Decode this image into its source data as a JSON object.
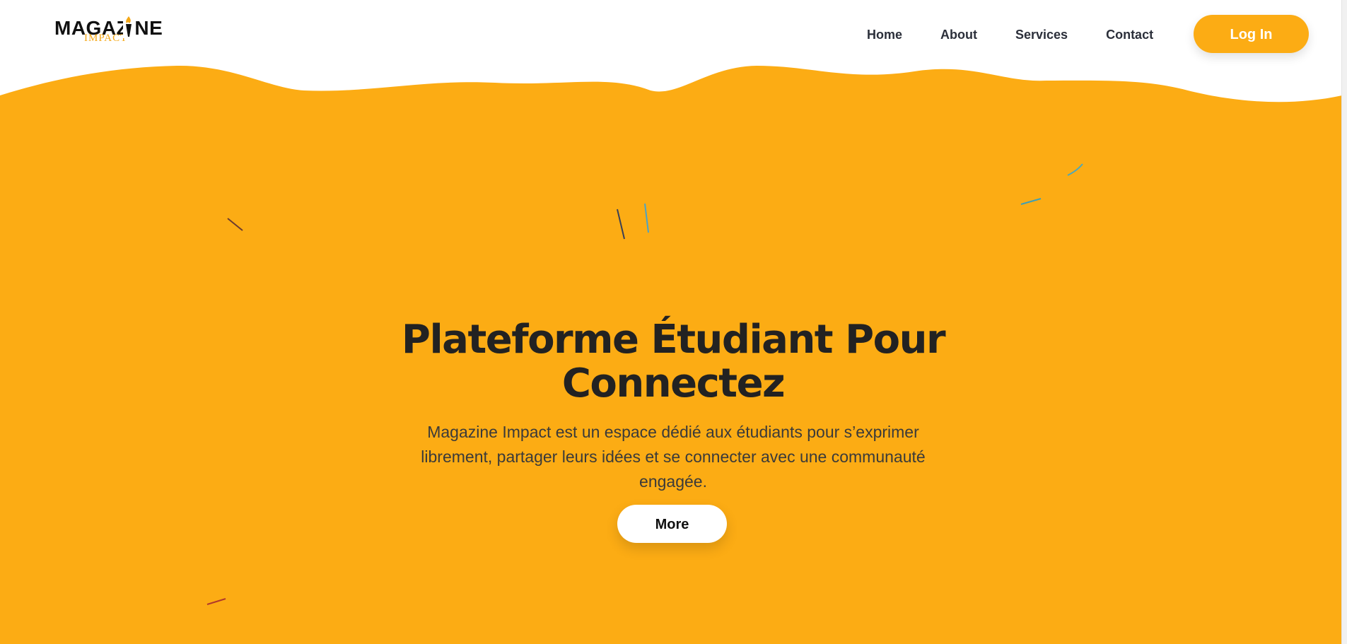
{
  "brand": {
    "logo_main": "MAGAZINE",
    "logo_sub": "IMPACT",
    "accent_color": "#fcac14",
    "text_color": "#222222"
  },
  "nav": {
    "items": [
      {
        "label": "Home"
      },
      {
        "label": "About"
      },
      {
        "label": "Services"
      },
      {
        "label": "Contact"
      }
    ],
    "login_label": "Log In"
  },
  "hero": {
    "title": "Plateforme Étudiant Pour Connectez",
    "description": "Magazine Impact est un espace dédié aux étudiants pour s’exprimer librement, partager leurs idées et se connecter avec une communauté engagée.",
    "cta_label": "More"
  },
  "icons": {
    "logo_torch": "torch-icon"
  }
}
